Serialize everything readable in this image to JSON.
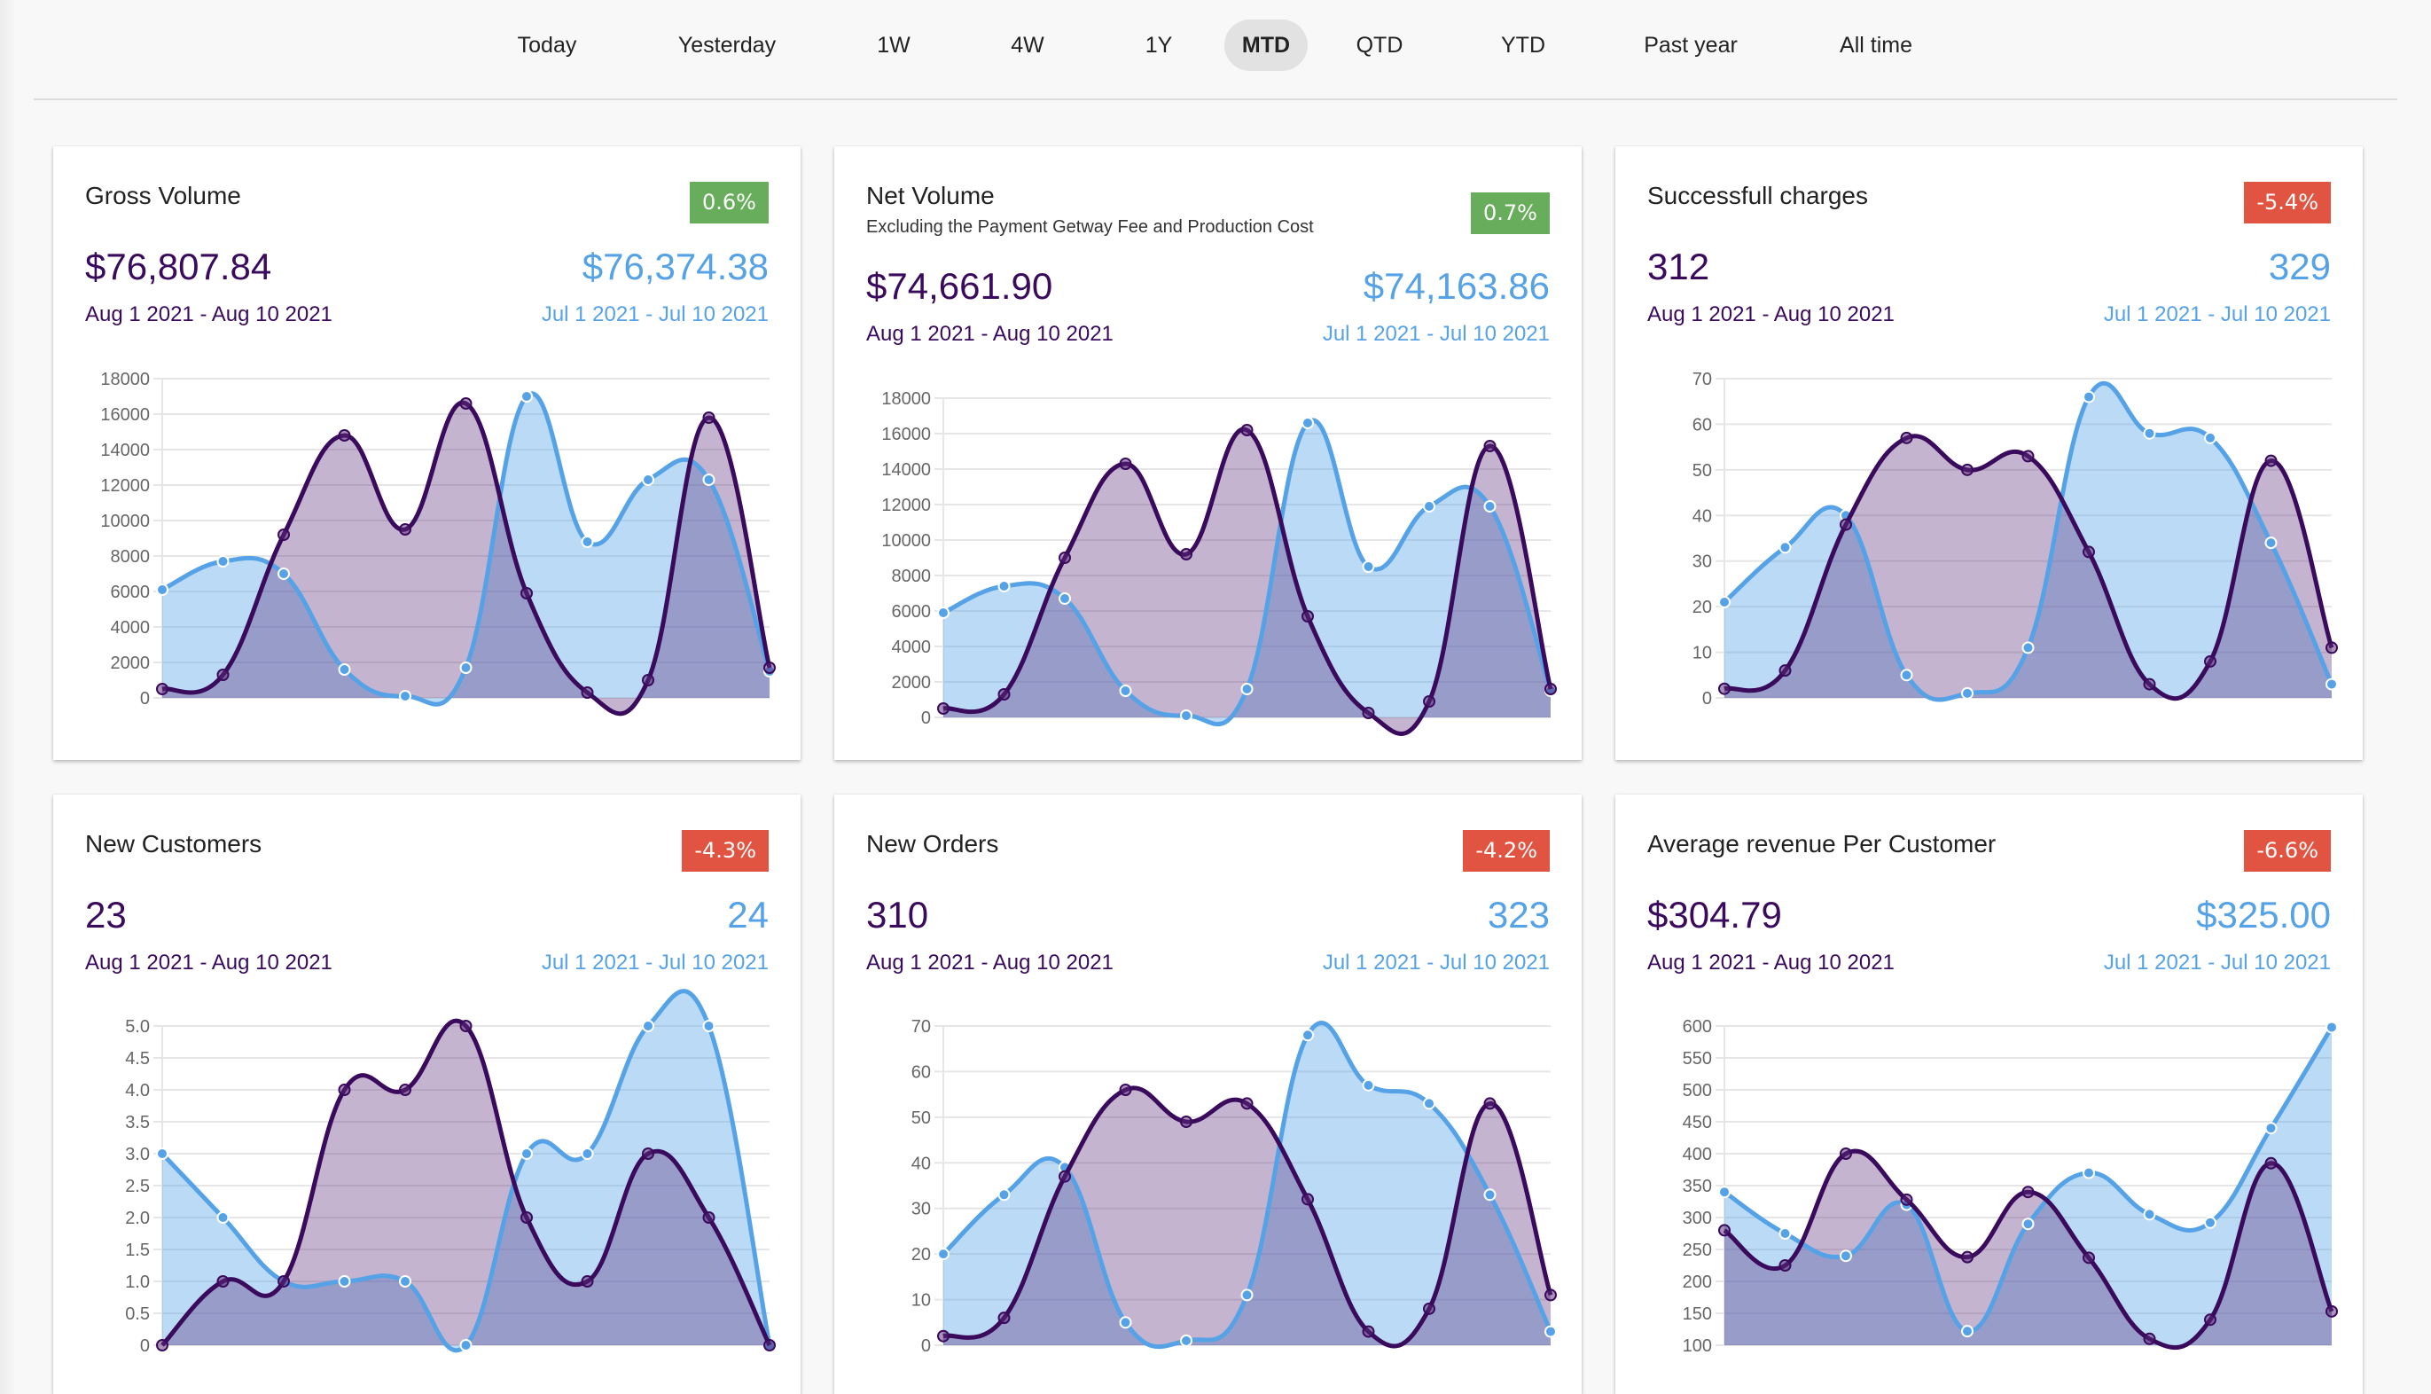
{
  "range_tabs": [
    {
      "label": "Today",
      "active": false
    },
    {
      "label": "Yesterday",
      "active": false
    },
    {
      "label": "1W",
      "active": false
    },
    {
      "label": "4W",
      "active": false
    },
    {
      "label": "1Y",
      "active": false
    },
    {
      "label": "MTD",
      "active": true
    },
    {
      "label": "QTD",
      "active": false
    },
    {
      "label": "YTD",
      "active": false
    },
    {
      "label": "Past year",
      "active": false
    },
    {
      "label": "All time",
      "active": false
    }
  ],
  "colors": {
    "current": "#3a0a5c",
    "previous": "#56a2e6",
    "positive_badge": "#67ad5b",
    "negative_badge": "#e05441"
  },
  "cards": [
    {
      "title": "Gross Volume",
      "subtitle": "",
      "change": "0.6%",
      "change_positive": true,
      "current_value": "$76,807.84",
      "previous_value": "$76,374.38",
      "current_range": "Aug 1 2021 - Aug 10 2021",
      "previous_range": "Jul 1 2021 - Jul 10 2021"
    },
    {
      "title": "Net Volume",
      "subtitle": "Excluding the Payment Getway Fee and Production Cost",
      "change": "0.7%",
      "change_positive": true,
      "current_value": "$74,661.90",
      "previous_value": "$74,163.86",
      "current_range": "Aug 1 2021 - Aug 10 2021",
      "previous_range": "Jul 1 2021 - Jul 10 2021"
    },
    {
      "title": "Successfull charges",
      "subtitle": "",
      "change": "-5.4%",
      "change_positive": false,
      "current_value": "312",
      "previous_value": "329",
      "current_range": "Aug 1 2021 - Aug 10 2021",
      "previous_range": "Jul 1 2021 - Jul 10 2021"
    },
    {
      "title": "New Customers",
      "subtitle": "",
      "change": "-4.3%",
      "change_positive": false,
      "current_value": "23",
      "previous_value": "24",
      "current_range": "Aug 1 2021 - Aug 10 2021",
      "previous_range": "Jul 1 2021 - Jul 10 2021"
    },
    {
      "title": "New Orders",
      "subtitle": "",
      "change": "-4.2%",
      "change_positive": false,
      "current_value": "310",
      "previous_value": "323",
      "current_range": "Aug 1 2021 - Aug 10 2021",
      "previous_range": "Jul 1 2021 - Jul 10 2021"
    },
    {
      "title": "Average revenue Per Customer",
      "subtitle": "",
      "change": "-6.6%",
      "change_positive": false,
      "current_value": "$304.79",
      "previous_value": "$325.00",
      "current_range": "Aug 1 2021 - Aug 10 2021",
      "previous_range": "Jul 1 2021 - Jul 10 2021"
    }
  ],
  "chart_data": [
    {
      "type": "area",
      "title": "Gross Volume",
      "ylim": [
        0,
        18000
      ],
      "yticks": [
        "0",
        "2000",
        "4000",
        "6000",
        "8000",
        "10000",
        "12000",
        "14000",
        "16000",
        "18000"
      ],
      "grid": true,
      "series": [
        {
          "name": "Aug 1 2021 - Aug 10 2021",
          "values": [
            500,
            1300,
            9200,
            14800,
            9500,
            16600,
            5900,
            300,
            1000,
            15800,
            1700
          ]
        },
        {
          "name": "Jul 1 2021 - Jul 10 2021",
          "values": [
            6100,
            7700,
            7000,
            1600,
            100,
            1700,
            17000,
            8800,
            12300,
            12300,
            1500
          ]
        }
      ]
    },
    {
      "type": "area",
      "title": "Net Volume",
      "ylim": [
        0,
        18000
      ],
      "yticks": [
        "0",
        "2000",
        "4000",
        "6000",
        "8000",
        "10000",
        "12000",
        "14000",
        "16000",
        "18000"
      ],
      "grid": true,
      "series": [
        {
          "name": "Aug 1 2021 - Aug 10 2021",
          "values": [
            500,
            1300,
            9000,
            14300,
            9200,
            16200,
            5700,
            250,
            900,
            15300,
            1600
          ]
        },
        {
          "name": "Jul 1 2021 - Jul 10 2021",
          "values": [
            5900,
            7400,
            6700,
            1500,
            100,
            1600,
            16600,
            8500,
            11900,
            11900,
            1500
          ]
        }
      ]
    },
    {
      "type": "area",
      "title": "Successfull charges",
      "ylim": [
        0,
        70
      ],
      "yticks": [
        "0",
        "10",
        "20",
        "30",
        "40",
        "50",
        "60",
        "70"
      ],
      "grid": true,
      "series": [
        {
          "name": "Aug 1 2021 - Aug 10 2021",
          "values": [
            2,
            6,
            38,
            57,
            50,
            53,
            32,
            3,
            8,
            52,
            11
          ]
        },
        {
          "name": "Jul 1 2021 - Jul 10 2021",
          "values": [
            21,
            33,
            40,
            5,
            1,
            11,
            66,
            58,
            57,
            34,
            3
          ]
        }
      ]
    },
    {
      "type": "area",
      "title": "New Customers",
      "ylim": [
        0,
        5
      ],
      "yticks": [
        "0",
        "0.5",
        "1.0",
        "1.5",
        "2.0",
        "2.5",
        "3.0",
        "3.5",
        "4.0",
        "4.5",
        "5.0"
      ],
      "grid": true,
      "series": [
        {
          "name": "Aug 1 2021 - Aug 10 2021",
          "values": [
            0,
            1,
            1,
            4,
            4,
            5,
            2,
            1,
            3,
            2,
            0
          ]
        },
        {
          "name": "Jul 1 2021 - Jul 10 2021",
          "values": [
            3,
            2,
            1,
            1,
            1,
            0,
            3,
            3,
            5,
            5,
            0
          ]
        }
      ]
    },
    {
      "type": "area",
      "title": "New Orders",
      "ylim": [
        0,
        70
      ],
      "yticks": [
        "0",
        "10",
        "20",
        "30",
        "40",
        "50",
        "60",
        "70"
      ],
      "grid": true,
      "series": [
        {
          "name": "Aug 1 2021 - Aug 10 2021",
          "values": [
            2,
            6,
            37,
            56,
            49,
            53,
            32,
            3,
            8,
            53,
            11
          ]
        },
        {
          "name": "Jul 1 2021 - Jul 10 2021",
          "values": [
            20,
            33,
            39,
            5,
            1,
            11,
            68,
            57,
            53,
            33,
            3
          ]
        }
      ]
    },
    {
      "type": "area",
      "title": "Average revenue Per Customer",
      "ylim": [
        100,
        600
      ],
      "yticks": [
        "100",
        "150",
        "200",
        "250",
        "300",
        "350",
        "400",
        "450",
        "500",
        "550",
        "600"
      ],
      "grid": true,
      "series": [
        {
          "name": "Aug 1 2021 - Aug 10 2021",
          "values": [
            280,
            225,
            400,
            328,
            238,
            340,
            237,
            110,
            140,
            385,
            153
          ]
        },
        {
          "name": "Jul 1 2021 - Jul 10 2021",
          "values": [
            340,
            275,
            240,
            320,
            122,
            290,
            370,
            305,
            292,
            440,
            598
          ]
        }
      ]
    }
  ]
}
